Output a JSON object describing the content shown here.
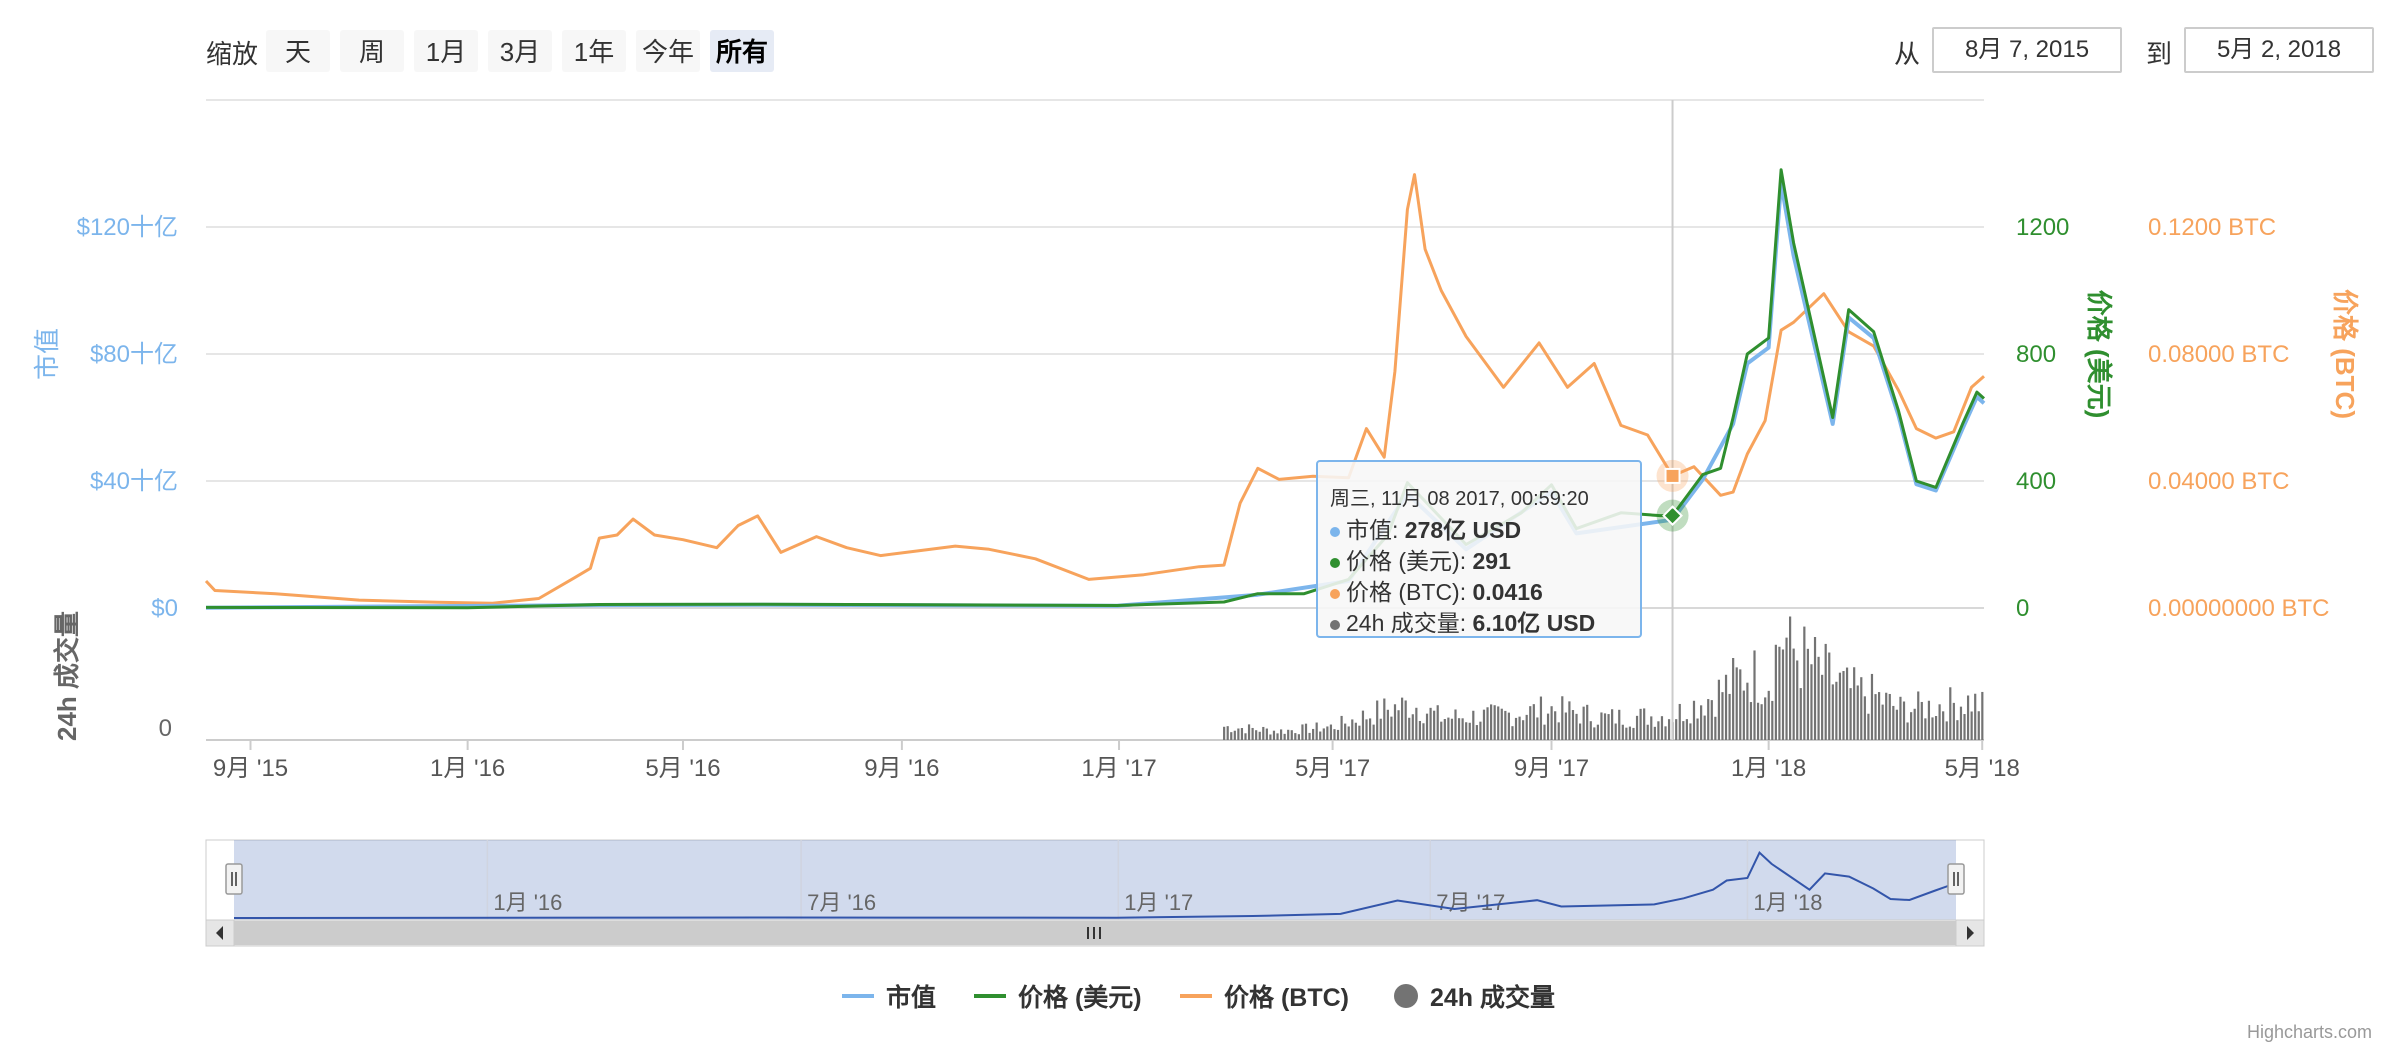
{
  "toolbar": {
    "zoom_label": "缩放",
    "buttons": [
      "天",
      "周",
      "1月",
      "3月",
      "1年",
      "今年",
      "所有"
    ],
    "active_button": "所有",
    "from_label": "从",
    "from_date": "8月 7, 2015",
    "to_label": "到",
    "to_date": "5月 2, 2018"
  },
  "tooltip": {
    "title": "周三, 11月 08 2017, 00:59:20",
    "rows": [
      {
        "label": "市值",
        "value": "278亿 USD",
        "color": "#7cb5ec"
      },
      {
        "label": "价格 (美元)",
        "value": "291",
        "color": "#2b908f"
      },
      {
        "label": "价格 (BTC)",
        "value": "0.0416",
        "color": "#f7a35c"
      },
      {
        "label": "24h 成交量",
        "value": "6.10亿 USD",
        "color": "#737373"
      }
    ]
  },
  "legend": [
    {
      "name": "市值",
      "color": "#7cb5ec",
      "type": "line"
    },
    {
      "name": "价格 (美元)",
      "color": "#2f8f2f",
      "type": "line"
    },
    {
      "name": "价格 (BTC)",
      "color": "#f7a35c",
      "type": "line"
    },
    {
      "name": "24h 成交量",
      "color": "#737373",
      "type": "dot"
    }
  ],
  "credits": "Highcharts.com",
  "chart_data": {
    "type": "line",
    "x_ticks": [
      "9月 '15",
      "1月 '16",
      "5月 '16",
      "9月 '16",
      "1月 '17",
      "5月 '17",
      "9月 '17",
      "1月 '18",
      "5月 '18"
    ],
    "navigator_ticks": [
      "1月 '16",
      "7月 '16",
      "1月 '17",
      "7月 '17",
      "1月 '18"
    ],
    "axes": {
      "market_cap": {
        "title": "市值",
        "ticks": [
          "$0",
          "$40十亿",
          "$80十亿",
          "$120十亿"
        ],
        "range": [
          0,
          160
        ],
        "color": "#7cb5ec"
      },
      "price_usd": {
        "title": "价格 (美元)",
        "ticks": [
          "0",
          "400",
          "800",
          "1200"
        ],
        "range": [
          0,
          1600
        ],
        "color": "#2f8f2f"
      },
      "price_btc": {
        "title": "价格 (BTC)",
        "ticks": [
          "0.00000000 BTC",
          "0.04000 BTC",
          "0.08000 BTC",
          "0.1200 BTC"
        ],
        "range": [
          0,
          0.16
        ],
        "color": "#f7a35c"
      },
      "volume": {
        "title": "24h 成交量",
        "ticks": [
          "0"
        ],
        "color": "#737373"
      }
    },
    "x_range": [
      "2015-08-07",
      "2018-05-02"
    ],
    "series": [
      {
        "name": "价格 (BTC)",
        "axis": "price_btc",
        "points": [
          [
            "2015-08-07",
            0.0085
          ],
          [
            "2015-08-12",
            0.0055
          ],
          [
            "2015-09-15",
            0.0045
          ],
          [
            "2015-11-01",
            0.0025
          ],
          [
            "2015-12-15",
            0.0018
          ],
          [
            "2016-01-15",
            0.0015
          ],
          [
            "2016-02-10",
            0.003
          ],
          [
            "2016-03-01",
            0.0095
          ],
          [
            "2016-03-10",
            0.0125
          ],
          [
            "2016-03-15",
            0.022
          ],
          [
            "2016-03-25",
            0.023
          ],
          [
            "2016-04-03",
            0.028
          ],
          [
            "2016-04-15",
            0.023
          ],
          [
            "2016-05-01",
            0.0215
          ],
          [
            "2016-05-20",
            0.019
          ],
          [
            "2016-06-01",
            0.026
          ],
          [
            "2016-06-12",
            0.029
          ],
          [
            "2016-06-25",
            0.0175
          ],
          [
            "2016-07-15",
            0.0225
          ],
          [
            "2016-08-01",
            0.019
          ],
          [
            "2016-08-20",
            0.0165
          ],
          [
            "2016-09-10",
            0.018
          ],
          [
            "2016-10-01",
            0.0195
          ],
          [
            "2016-10-20",
            0.0185
          ],
          [
            "2016-11-15",
            0.0155
          ],
          [
            "2016-12-15",
            0.009
          ],
          [
            "2017-01-15",
            0.0105
          ],
          [
            "2017-02-15",
            0.013
          ],
          [
            "2017-03-01",
            0.0135
          ],
          [
            "2017-03-10",
            0.033
          ],
          [
            "2017-03-20",
            0.044
          ],
          [
            "2017-04-01",
            0.0405
          ],
          [
            "2017-04-20",
            0.0415
          ],
          [
            "2017-05-10",
            0.041
          ],
          [
            "2017-05-20",
            0.0565
          ],
          [
            "2017-05-30",
            0.0475
          ],
          [
            "2017-06-05",
            0.0745
          ],
          [
            "2017-06-12",
            0.1255
          ],
          [
            "2017-06-16",
            0.1365
          ],
          [
            "2017-06-22",
            0.113
          ],
          [
            "2017-07-01",
            0.1
          ],
          [
            "2017-07-15",
            0.0855
          ],
          [
            "2017-08-05",
            0.0695
          ],
          [
            "2017-08-25",
            0.0835
          ],
          [
            "2017-09-10",
            0.0695
          ],
          [
            "2017-09-25",
            0.077
          ],
          [
            "2017-10-10",
            0.0575
          ],
          [
            "2017-10-25",
            0.0545
          ],
          [
            "2017-11-08",
            0.0416
          ],
          [
            "2017-11-20",
            0.0445
          ],
          [
            "2017-12-05",
            0.0355
          ],
          [
            "2017-12-12",
            0.0365
          ],
          [
            "2017-12-20",
            0.0485
          ],
          [
            "2017-12-30",
            0.059
          ],
          [
            "2018-01-08",
            0.0875
          ],
          [
            "2018-01-15",
            0.09
          ],
          [
            "2018-02-01",
            0.099
          ],
          [
            "2018-02-15",
            0.087
          ],
          [
            "2018-03-01",
            0.0825
          ],
          [
            "2018-03-15",
            0.0685
          ],
          [
            "2018-03-25",
            0.0565
          ],
          [
            "2018-04-05",
            0.0535
          ],
          [
            "2018-04-15",
            0.0555
          ],
          [
            "2018-04-25",
            0.0695
          ],
          [
            "2018-05-02",
            0.073
          ]
        ]
      },
      {
        "name": "价格 (美元)",
        "axis": "price_usd",
        "points": [
          [
            "2015-08-07",
            2
          ],
          [
            "2016-01-01",
            1
          ],
          [
            "2016-03-15",
            11
          ],
          [
            "2016-06-15",
            12
          ],
          [
            "2016-12-31",
            8
          ],
          [
            "2017-03-01",
            19
          ],
          [
            "2017-03-20",
            45
          ],
          [
            "2017-04-15",
            45
          ],
          [
            "2017-05-10",
            90
          ],
          [
            "2017-06-01",
            230
          ],
          [
            "2017-06-12",
            395
          ],
          [
            "2017-07-15",
            200
          ],
          [
            "2017-08-15",
            300
          ],
          [
            "2017-09-01",
            388
          ],
          [
            "2017-09-15",
            250
          ],
          [
            "2017-10-10",
            300
          ],
          [
            "2017-11-01",
            291
          ],
          [
            "2017-11-08",
            291
          ],
          [
            "2017-11-25",
            420
          ],
          [
            "2017-12-05",
            440
          ],
          [
            "2017-12-12",
            600
          ],
          [
            "2017-12-20",
            800
          ],
          [
            "2018-01-01",
            850
          ],
          [
            "2018-01-08",
            1380
          ],
          [
            "2018-01-15",
            1150
          ],
          [
            "2018-02-06",
            600
          ],
          [
            "2018-02-15",
            940
          ],
          [
            "2018-03-01",
            870
          ],
          [
            "2018-03-15",
            620
          ],
          [
            "2018-03-25",
            400
          ],
          [
            "2018-04-05",
            380
          ],
          [
            "2018-04-20",
            580
          ],
          [
            "2018-04-28",
            680
          ],
          [
            "2018-05-02",
            660
          ]
        ]
      },
      {
        "name": "市值",
        "axis": "market_cap",
        "points": [
          [
            "2015-08-07",
            0.1
          ],
          [
            "2016-03-15",
            0.9
          ],
          [
            "2016-06-15",
            1.0
          ],
          [
            "2016-12-31",
            0.7
          ],
          [
            "2017-03-20",
            4.2
          ],
          [
            "2017-05-10",
            8.5
          ],
          [
            "2017-06-12",
            36
          ],
          [
            "2017-07-15",
            18.5
          ],
          [
            "2017-09-01",
            36.5
          ],
          [
            "2017-09-15",
            23.5
          ],
          [
            "2017-11-08",
            27.8
          ],
          [
            "2017-11-25",
            40.5
          ],
          [
            "2017-12-12",
            58
          ],
          [
            "2017-12-20",
            77
          ],
          [
            "2018-01-01",
            82
          ],
          [
            "2018-01-08",
            134
          ],
          [
            "2018-01-15",
            111
          ],
          [
            "2018-02-06",
            58
          ],
          [
            "2018-02-15",
            91.5
          ],
          [
            "2018-03-01",
            85
          ],
          [
            "2018-03-15",
            60.5
          ],
          [
            "2018-03-25",
            39
          ],
          [
            "2018-04-05",
            37
          ],
          [
            "2018-04-20",
            56.5
          ],
          [
            "2018-04-28",
            66.5
          ],
          [
            "2018-05-02",
            64.5
          ]
        ]
      },
      {
        "name": "24h 成交量",
        "axis": "volume",
        "type": "column",
        "points": [
          [
            "2017-03-01",
            0.12
          ],
          [
            "2017-04-01",
            0.08
          ],
          [
            "2017-05-01",
            0.12
          ],
          [
            "2017-06-01",
            0.28
          ],
          [
            "2017-06-15",
            0.32
          ],
          [
            "2017-07-01",
            0.2
          ],
          [
            "2017-08-01",
            0.22
          ],
          [
            "2017-09-01",
            0.28
          ],
          [
            "2017-10-01",
            0.2
          ],
          [
            "2017-11-08",
            0.22
          ],
          [
            "2017-12-01",
            0.4
          ],
          [
            "2017-12-20",
            0.6
          ],
          [
            "2018-01-01",
            0.55
          ],
          [
            "2018-01-08",
            0.95
          ],
          [
            "2018-01-15",
            0.8
          ],
          [
            "2018-02-01",
            0.6
          ],
          [
            "2018-02-15",
            0.45
          ],
          [
            "2018-03-01",
            0.4
          ],
          [
            "2018-03-15",
            0.28
          ],
          [
            "2018-04-01",
            0.3
          ],
          [
            "2018-04-25",
            0.35
          ],
          [
            "2018-05-02",
            0.3
          ]
        ]
      }
    ],
    "hover_date": "2017-11-08",
    "grid": true
  }
}
